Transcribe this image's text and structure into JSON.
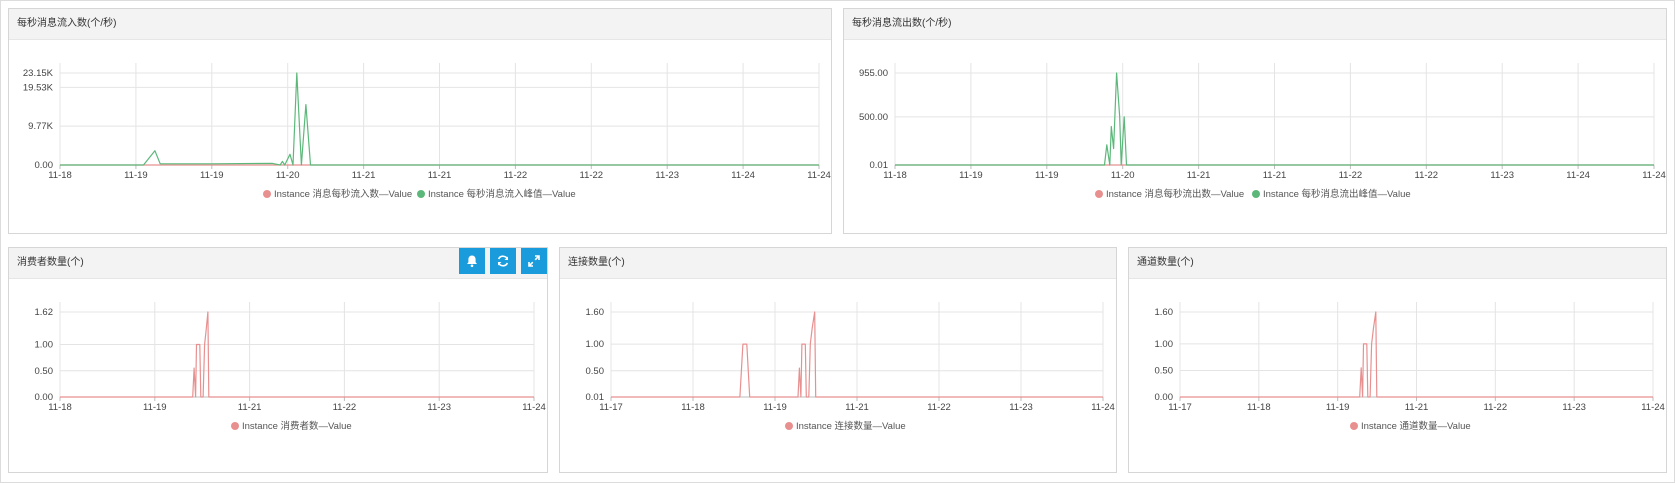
{
  "colors": {
    "grid": "#e4e4e4",
    "axis": "#bdbdbd",
    "toolbar_button": "#1a9bdb"
  },
  "toolbar": {
    "icons": [
      "bell-icon",
      "refresh-icon",
      "expand-icon"
    ]
  },
  "panels": [
    {
      "title": "每秒消息流入数(个/秒)"
    },
    {
      "title": "每秒消息流出数(个/秒)"
    },
    {
      "title": "消费者数量(个)"
    },
    {
      "title": "连接数量(个)"
    },
    {
      "title": "通道数量(个)"
    }
  ],
  "chart_data": [
    {
      "type": "line",
      "title": "每秒消息流入数(个/秒)",
      "x_range": [
        "11-18",
        "11-24"
      ],
      "x_ticks": [
        "11-18",
        "11-19",
        "11-19",
        "11-20",
        "11-21",
        "11-21",
        "11-22",
        "11-22",
        "11-23",
        "11-24",
        "11-24"
      ],
      "y_ticks": [
        "0.00",
        "9.77K",
        "19.53K",
        "23.15K"
      ],
      "ylim": [
        0,
        23150
      ],
      "grid": true,
      "legend": "bottom-center",
      "series": [
        {
          "name": "Instance 消息每秒流入数—Value",
          "color": "#e89090",
          "points": [
            [
              0,
              0
            ],
            [
              1,
              0
            ]
          ]
        },
        {
          "name": "Instance 每秒消息流入峰值—Value",
          "color": "#5cb87a",
          "points": [
            [
              0,
              0
            ],
            [
              0.11,
              0
            ],
            [
              0.125,
              3600
            ],
            [
              0.132,
              300
            ],
            [
              0.2,
              300
            ],
            [
              0.28,
              400
            ],
            [
              0.29,
              0
            ],
            [
              0.293,
              900
            ],
            [
              0.296,
              0
            ],
            [
              0.303,
              2700
            ],
            [
              0.307,
              0
            ],
            [
              0.312,
              23150
            ],
            [
              0.318,
              0
            ],
            [
              0.324,
              15200
            ],
            [
              0.33,
              0
            ],
            [
              1,
              0
            ]
          ]
        }
      ]
    },
    {
      "type": "line",
      "title": "每秒消息流出数(个/秒)",
      "x_range": [
        "11-18",
        "11-24"
      ],
      "x_ticks": [
        "11-18",
        "11-19",
        "11-19",
        "11-20",
        "11-21",
        "11-21",
        "11-22",
        "11-22",
        "11-23",
        "11-24",
        "11-24"
      ],
      "y_ticks": [
        "0.01",
        "500.00",
        "955.00"
      ],
      "ylim": [
        0.01,
        955
      ],
      "grid": true,
      "legend": "bottom-center",
      "series": [
        {
          "name": "Instance 消息每秒流出数—Value",
          "color": "#e89090",
          "points": [
            [
              0,
              0.01
            ],
            [
              1,
              0.01
            ]
          ]
        },
        {
          "name": "Instance 每秒消息流出峰值—Value",
          "color": "#5cb87a",
          "points": [
            [
              0,
              0.01
            ],
            [
              0.276,
              0.01
            ],
            [
              0.279,
              210
            ],
            [
              0.283,
              0.01
            ],
            [
              0.285,
              400
            ],
            [
              0.288,
              170
            ],
            [
              0.292,
              955
            ],
            [
              0.296,
              500
            ],
            [
              0.298,
              0.01
            ],
            [
              0.302,
              500
            ],
            [
              0.305,
              0.01
            ],
            [
              1,
              0.01
            ]
          ]
        }
      ]
    },
    {
      "type": "line",
      "title": "消费者数量(个)",
      "x_range": [
        "11-18",
        "11-24"
      ],
      "x_ticks": [
        "11-18",
        "11-19",
        "11-21",
        "11-22",
        "11-23",
        "11-24"
      ],
      "y_ticks": [
        "0.00",
        "0.50",
        "1.00",
        "1.62"
      ],
      "ylim": [
        0,
        1.62
      ],
      "grid": true,
      "legend": "bottom-center",
      "series": [
        {
          "name": "Instance 消费者数—Value",
          "color": "#e89090",
          "points": [
            [
              0,
              0
            ],
            [
              0.28,
              0
            ],
            [
              0.283,
              0.55
            ],
            [
              0.286,
              0
            ],
            [
              0.288,
              1.0
            ],
            [
              0.295,
              1.0
            ],
            [
              0.297,
              0
            ],
            [
              0.302,
              0
            ],
            [
              0.305,
              1.0
            ],
            [
              0.308,
              1.25
            ],
            [
              0.312,
              1.62
            ],
            [
              0.314,
              0
            ],
            [
              1,
              0
            ]
          ]
        }
      ]
    },
    {
      "type": "line",
      "title": "连接数量(个)",
      "x_range": [
        "11-17",
        "11-24"
      ],
      "x_ticks": [
        "11-17",
        "11-18",
        "11-19",
        "11-21",
        "11-22",
        "11-23",
        "11-24"
      ],
      "y_ticks": [
        "0.01",
        "0.50",
        "1.00",
        "1.60"
      ],
      "ylim": [
        0.01,
        1.6
      ],
      "grid": true,
      "legend": "bottom-center",
      "series": [
        {
          "name": "Instance 连接数量—Value",
          "color": "#e89090",
          "points": [
            [
              0,
              0.01
            ],
            [
              0.262,
              0.01
            ],
            [
              0.268,
              1.0
            ],
            [
              0.276,
              1.0
            ],
            [
              0.282,
              0.01
            ],
            [
              0.38,
              0.01
            ],
            [
              0.383,
              0.55
            ],
            [
              0.386,
              0.01
            ],
            [
              0.388,
              1.0
            ],
            [
              0.395,
              1.0
            ],
            [
              0.397,
              0.01
            ],
            [
              0.402,
              0.01
            ],
            [
              0.405,
              1.0
            ],
            [
              0.409,
              1.3
            ],
            [
              0.414,
              1.6
            ],
            [
              0.416,
              0.01
            ],
            [
              1,
              0.01
            ]
          ]
        }
      ]
    },
    {
      "type": "line",
      "title": "通道数量(个)",
      "x_range": [
        "11-17",
        "11-24"
      ],
      "x_ticks": [
        "11-17",
        "11-18",
        "11-19",
        "11-21",
        "11-22",
        "11-23",
        "11-24"
      ],
      "y_ticks": [
        "0.00",
        "0.50",
        "1.00",
        "1.60"
      ],
      "ylim": [
        0,
        1.6
      ],
      "grid": true,
      "legend": "bottom-center",
      "series": [
        {
          "name": "Instance 通道数量—Value",
          "color": "#e89090",
          "points": [
            [
              0,
              0
            ],
            [
              0.38,
              0
            ],
            [
              0.383,
              0.55
            ],
            [
              0.386,
              0
            ],
            [
              0.388,
              1.0
            ],
            [
              0.395,
              1.0
            ],
            [
              0.397,
              0
            ],
            [
              0.402,
              0
            ],
            [
              0.405,
              1.0
            ],
            [
              0.409,
              1.3
            ],
            [
              0.414,
              1.6
            ],
            [
              0.416,
              0
            ],
            [
              1,
              0
            ]
          ]
        }
      ]
    }
  ]
}
